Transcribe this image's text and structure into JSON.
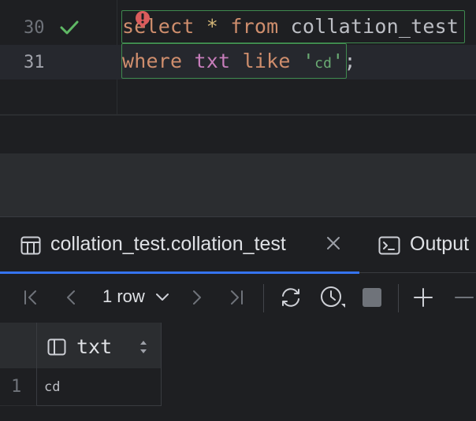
{
  "editor": {
    "lines": [
      {
        "number": "30",
        "status": "check-icon",
        "tokens": {
          "kw1": "select",
          "op": "*",
          "kw2": "from",
          "table": "collation_test"
        }
      },
      {
        "number": "31",
        "tokens": {
          "kw1": "where",
          "col": "txt",
          "kw2": "like",
          "str_open": "'",
          "str_val": "cd",
          "str_close": "'",
          "semi": ";"
        }
      }
    ],
    "error_marker": "error-icon"
  },
  "results": {
    "tabs": [
      {
        "label": "collation_test.collation_test",
        "active": true,
        "icon": "table-icon"
      },
      {
        "label": "Output",
        "active": false,
        "icon": "console-icon"
      }
    ],
    "toolbar": {
      "row_count": "1 row"
    },
    "grid": {
      "columns": [
        {
          "label": "txt",
          "icon": "column-icon"
        }
      ],
      "rows": [
        {
          "num": "1",
          "cells": [
            "cd"
          ]
        }
      ]
    }
  },
  "colors": {
    "keyword": "#cf8e6d",
    "column": "#c77dbb",
    "string": "#6aab73",
    "accent": "#3574f0",
    "success": "#5fb865",
    "error": "#db5c5c"
  }
}
